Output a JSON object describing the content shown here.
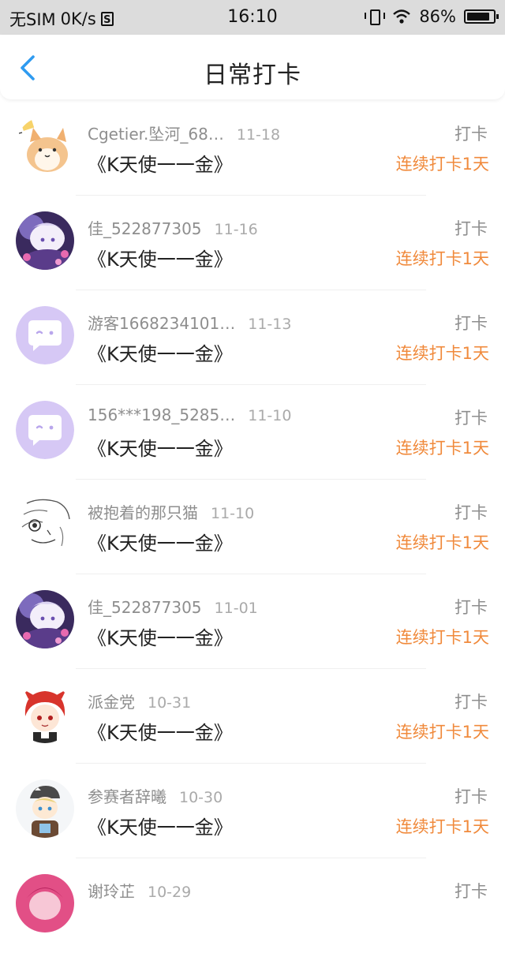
{
  "status_bar": {
    "carrier": "无SIM",
    "speed": "0K/s",
    "sim_icon": "S",
    "time": "16:10",
    "battery_percent": "86%",
    "battery_level": 0.86
  },
  "header": {
    "title": "日常打卡",
    "back_icon": "chevron-left-icon",
    "accent": "#2f9bf0"
  },
  "colors": {
    "streak": "#f08a3c",
    "avatar_purple": "#d6c8f5"
  },
  "items": [
    {
      "username": "Cgetier.坠河_68…",
      "date": "11-18",
      "content": "《K天使一一金》",
      "type": "打卡",
      "streak": "连续打卡1天",
      "avatar": "cat-avatar"
    },
    {
      "username": "佳_522877305",
      "date": "11-16",
      "content": "《K天使一一金》",
      "type": "打卡",
      "streak": "连续打卡1天",
      "avatar": "anime-purple-avatar"
    },
    {
      "username": "游客1668234101…",
      "date": "11-13",
      "content": "《K天使一一金》",
      "type": "打卡",
      "streak": "连续打卡1天",
      "avatar": "default-chat-avatar"
    },
    {
      "username": "156***198_5285…",
      "date": "11-10",
      "content": "《K天使一一金》",
      "type": "打卡",
      "streak": "连续打卡1天",
      "avatar": "default-chat-avatar"
    },
    {
      "username": "被抱着的那只猫",
      "date": "11-10",
      "content": "《K天使一一金》",
      "type": "打卡",
      "streak": "连续打卡1天",
      "avatar": "sketch-avatar"
    },
    {
      "username": "佳_522877305",
      "date": "11-01",
      "content": "《K天使一一金》",
      "type": "打卡",
      "streak": "连续打卡1天",
      "avatar": "anime-purple-avatar"
    },
    {
      "username": "派金党",
      "date": "10-31",
      "content": "《K天使一一金》",
      "type": "打卡",
      "streak": "连续打卡1天",
      "avatar": "red-hair-avatar"
    },
    {
      "username": "参赛者辞曦",
      "date": "10-30",
      "content": "《K天使一一金》",
      "type": "打卡",
      "streak": "连续打卡1天",
      "avatar": "chibi-avatar"
    },
    {
      "username": "谢玲芷",
      "date": "10-29",
      "content": "",
      "type": "打卡",
      "streak": "",
      "avatar": "pink-avatar"
    }
  ]
}
